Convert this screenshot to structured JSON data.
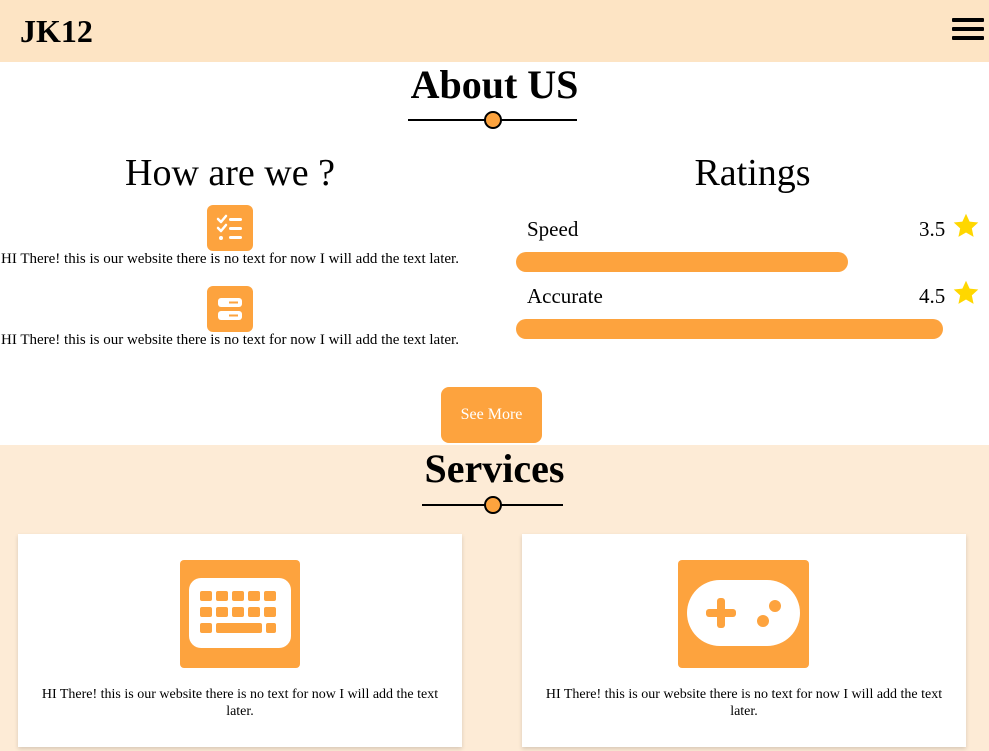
{
  "navbar": {
    "brand": "JK12",
    "menu_icon": "hamburger-menu-icon"
  },
  "about": {
    "title": "About US",
    "how": {
      "heading": "How are we ?",
      "items": [
        {
          "icon": "checklist-icon",
          "text": "HI There! this is our website there is no text for now I will add the text later."
        },
        {
          "icon": "server-icon",
          "text": "HI There! this is our website there is no text for now I will add the text later."
        }
      ]
    },
    "ratings": {
      "heading": "Ratings",
      "items": [
        {
          "label": "Speed",
          "value": "3.5",
          "fill": 0.7
        },
        {
          "label": "Accurate",
          "value": "4.5",
          "fill": 0.9
        }
      ]
    },
    "see_more": "See More"
  },
  "services": {
    "title": "Services",
    "cards": [
      {
        "icon": "keyboard-icon",
        "text": "HI There! this is our website there is no text for now I will add the text later."
      },
      {
        "icon": "gamepad-icon",
        "text": "HI There! this is our website there is no text for now I will add the text later."
      }
    ]
  },
  "colors": {
    "accent": "#fda33e",
    "nav_bg": "#fde4c4",
    "services_bg": "#fdebd6",
    "star": "#ffd700"
  }
}
